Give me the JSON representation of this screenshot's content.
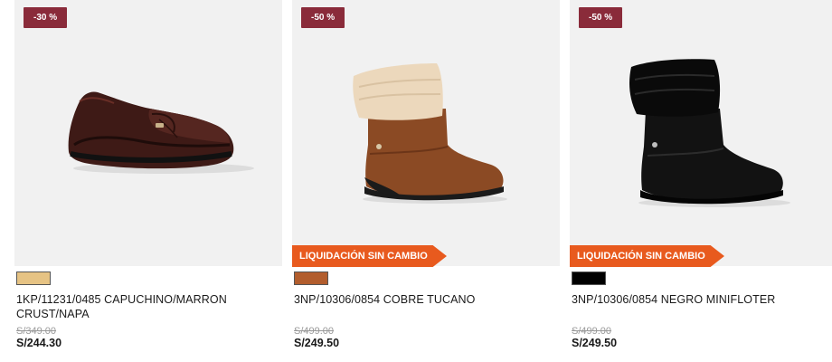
{
  "products": [
    {
      "discount": "-30 %",
      "swatch_color": "#e6c384",
      "name": "1KP/11231/0485 CAPUCHINO/MARRON CRUST/NAPA",
      "old_price": "S/349.00",
      "price": "S/244.30",
      "image": "brown-leather-loafer"
    },
    {
      "discount": "-50 %",
      "badge": "LIQUIDACIÓN SIN CAMBIO",
      "swatch_color": "#b25d2d",
      "name": "3NP/10306/0854 COBRE TUCANO",
      "old_price": "S/499.00",
      "price": "S/249.50",
      "image": "tan-ankle-boot-with-shearling-cuff"
    },
    {
      "discount": "-50 %",
      "badge": "LIQUIDACIÓN SIN CAMBIO",
      "swatch_color": "#000000",
      "name": "3NP/10306/0854 NEGRO MINIFLOTER",
      "old_price": "S/499.00",
      "price": "S/249.50",
      "image": "black-ankle-boot-with-fur-cuff"
    }
  ],
  "colors": {
    "discount_badge": "#8a2b3a",
    "liquidation_badge": "#e85a1e",
    "image_background": "#f1f1f1"
  }
}
